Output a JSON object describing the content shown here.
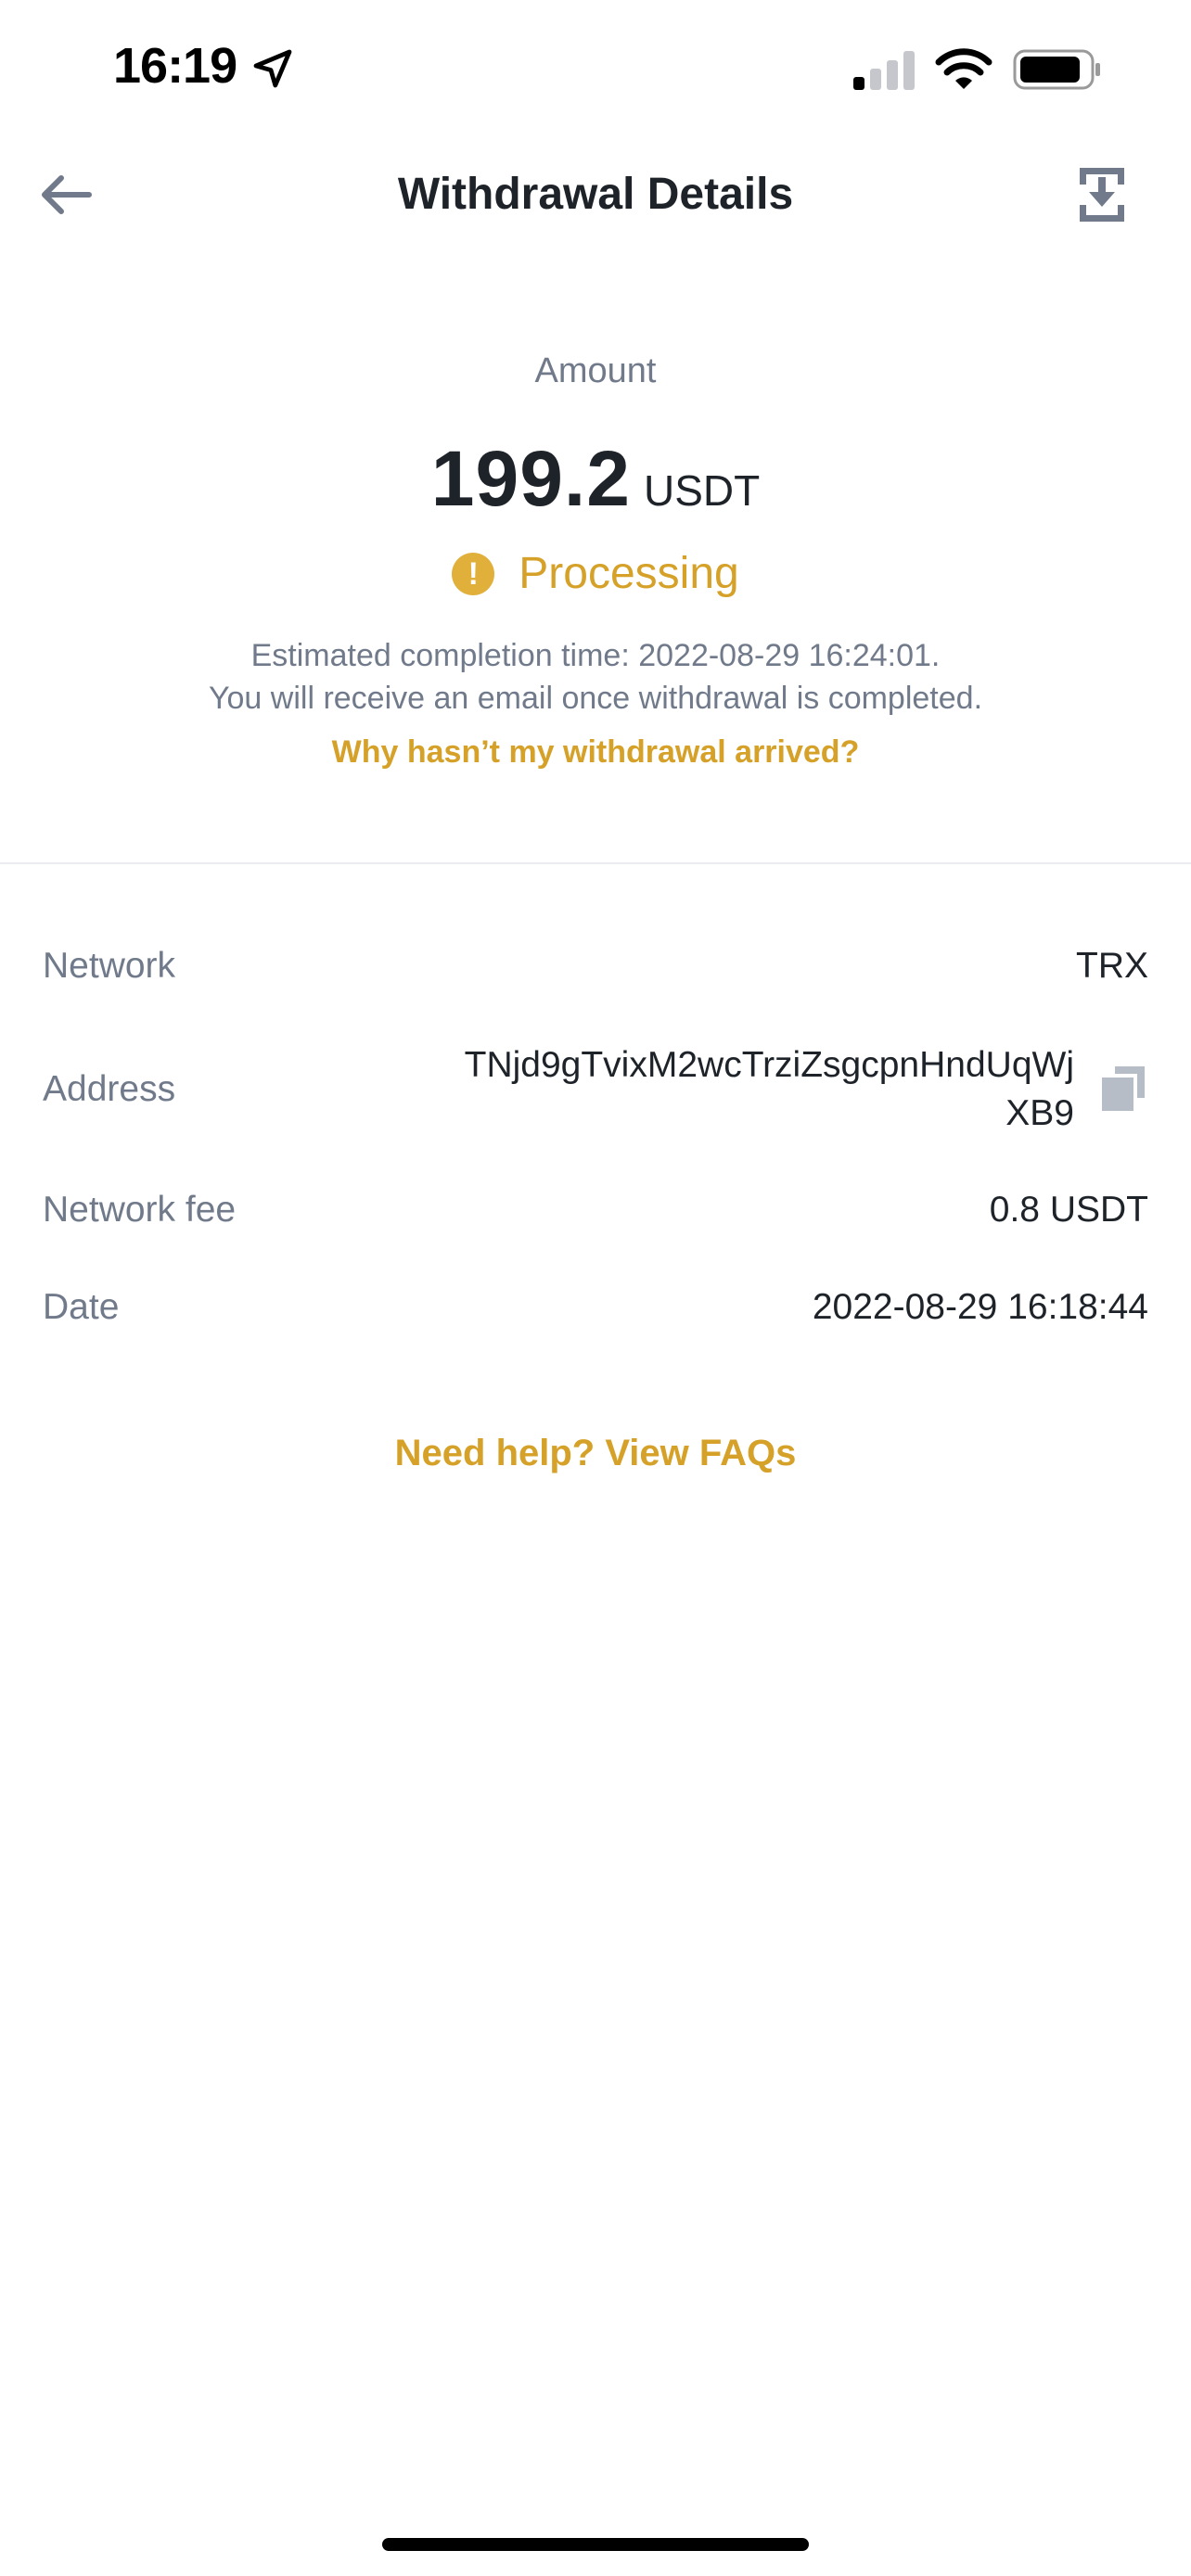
{
  "status_bar": {
    "time": "16:19",
    "icons": [
      "location-arrow-icon",
      "cellular-signal-icon",
      "wifi-icon",
      "battery-icon"
    ]
  },
  "header": {
    "title": "Withdrawal Details",
    "back_icon": "arrow-left-icon",
    "download_icon": "download-tray-icon"
  },
  "summary": {
    "amount_label": "Amount",
    "amount_value": "199.2",
    "amount_unit": "USDT",
    "status_icon_glyph": "!",
    "status": "Processing",
    "estimate_text": "Estimated completion time: 2022-08-29 16:24:01.",
    "email_text": "You will receive an email once withdrawal is completed.",
    "why_link": "Why hasn’t my withdrawal arrived?"
  },
  "details": {
    "network_label": "Network",
    "network_value": "TRX",
    "address_label": "Address",
    "address_value": "TNjd9gTvixM2wcTrziZsgcpnHndUqWjXB9",
    "fee_label": "Network fee",
    "fee_value": "0.8 USDT",
    "date_label": "Date",
    "date_value": "2022-08-29 16:18:44"
  },
  "help_link": "Need help? View FAQs",
  "colors": {
    "accent": "#d5a128",
    "status_icon": "#e0b03a",
    "text_primary": "#1e2329",
    "text_secondary": "#707a8a",
    "divider": "#eaecef"
  }
}
